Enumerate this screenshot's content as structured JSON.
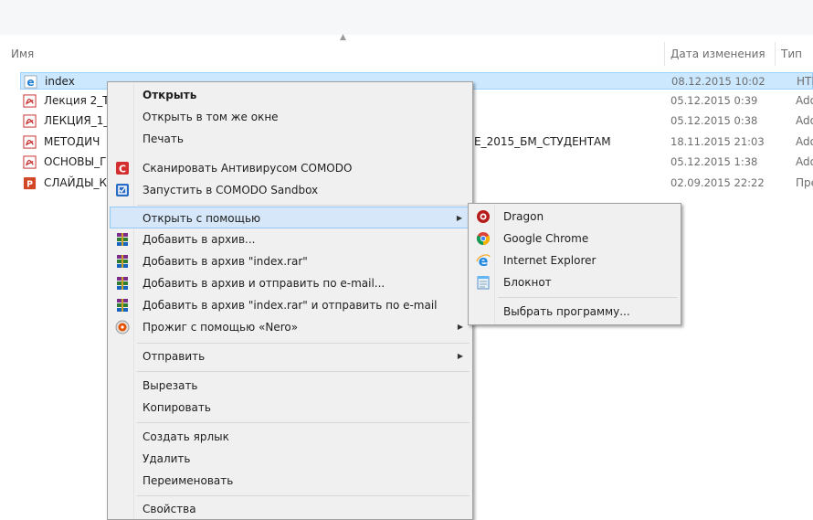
{
  "columns": {
    "name": "Имя",
    "date": "Дата изменения",
    "type": "Тип"
  },
  "files": [
    {
      "name": "index",
      "name_tail": "",
      "date": "08.12.2015 10:02",
      "type": "HTML",
      "icon": "ie-html-icon",
      "selected": true
    },
    {
      "name": "Лекция 2_Т",
      "name_tail": "",
      "date": "05.12.2015 0:39",
      "type": "Adobe",
      "icon": "pdf-icon"
    },
    {
      "name": "ЛЕКЦИЯ_1_",
      "name_tail": "",
      "date": "05.12.2015 0:38",
      "type": "Adobe",
      "icon": "pdf-icon"
    },
    {
      "name": "МЕТОДИЧ",
      "name_tail": "Е_2015_БМ_СТУДЕНТАМ",
      "date": "18.11.2015 21:03",
      "type": "Adobe",
      "icon": "pdf-icon"
    },
    {
      "name": "ОСНОВЫ_Г",
      "name_tail": "",
      "date": "05.12.2015 1:38",
      "type": "Adobe",
      "icon": "pdf-icon"
    },
    {
      "name": "СЛАЙДЫ_К",
      "name_tail": "",
      "date": "02.09.2015 22:22",
      "type": "Пре",
      "icon": "pptx-icon"
    }
  ],
  "context_menu": {
    "open": "Открыть",
    "open_same_window": "Открыть в том же окне",
    "print": "Печать",
    "scan_comodo": "Сканировать Антивирусом COMODO",
    "comodo_sandbox": "Запустить в COMODO Sandbox",
    "open_with": "Открыть с помощью",
    "add_archive": "Добавить в архив...",
    "add_index_rar": "Добавить в архив \"index.rar\"",
    "add_archive_email": "Добавить в архив и отправить по e-mail...",
    "add_index_rar_email": "Добавить в архив \"index.rar\" и отправить по e-mail",
    "burn_nero": "Прожиг с помощью «Nero»",
    "send_to": "Отправить",
    "cut": "Вырезать",
    "copy": "Копировать",
    "create_shortcut": "Создать ярлык",
    "delete": "Удалить",
    "rename": "Переименовать",
    "properties": "Свойства"
  },
  "open_with_menu": {
    "dragon": "Dragon",
    "chrome": "Google Chrome",
    "ie": "Internet Explorer",
    "notepad": "Блокнот",
    "choose": "Выбрать программу..."
  },
  "colors": {
    "selection": "#cce8ff",
    "menu_bg": "#f0f0f0",
    "menu_highlight": "#d5e7f8"
  }
}
